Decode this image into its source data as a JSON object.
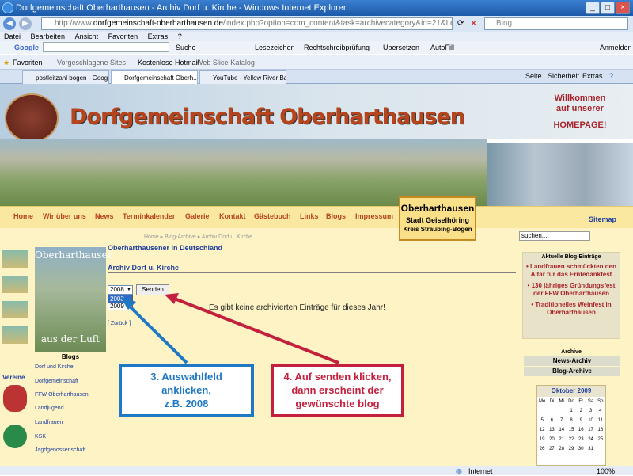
{
  "window": {
    "title": "Dorfgemeinschaft Oberharthausen - Archiv Dorf u. Kirche - Windows Internet Explorer"
  },
  "address": {
    "url_prefix": "http://www.",
    "url_domain": "dorfgemeinschaft-oberharthausen.de",
    "url_rest": "/index.php?option=com_content&task=archivecategory&id=21&Itemid=102",
    "search_placeholder": "Bing"
  },
  "menu": [
    "Datei",
    "Bearbeiten",
    "Ansicht",
    "Favoriten",
    "Extras",
    "?"
  ],
  "google_toolbar": {
    "logo": "Google",
    "suche": "Suche",
    "lesezeichen": "Lesezeichen",
    "rechtschreib": "Rechtschreibprüfung",
    "uebersetzen": "Übersetzen",
    "autofill": "AutoFill",
    "anmelden": "Anmelden"
  },
  "favorites_bar": {
    "favoriten": "Favoriten",
    "vorgeschlagen": "Vorgeschlagene Sites",
    "hotmail": "Kostenlose Hotmail",
    "webslice": "Web Slice-Katalog"
  },
  "tabs": [
    "postleitzahl bogen - Google-S...",
    "Dorfgemeinschaft Oberh...",
    "YouTube - Yellow River Band ..."
  ],
  "cmdbar": {
    "seite": "Seite",
    "sicherheit": "Sicherheit",
    "extras": "Extras"
  },
  "site": {
    "title": "Dorfgemeinschaft Oberharthausen",
    "welcome1": "Willkommen",
    "welcome2": "auf unserer",
    "homepage": "HOMEPAGE!",
    "nav": [
      "Home",
      "Wir über uns",
      "News",
      "Terminkalender",
      "Galerie",
      "Kontakt",
      "Gästebuch",
      "Links",
      "Blogs",
      "Impressum"
    ],
    "location": {
      "name": "Oberharthausen",
      "city": "Stadt Geiselhöring",
      "district": "Kreis Straubing-Bogen"
    },
    "sitemap": "Sitemap",
    "search_placeholder": "suchen...",
    "breadcrumb": "Home ▸ Blog-Archive ▸ Archiv Dorf u. Kirche",
    "section_title": "Oberharthausener in Deutschland",
    "archive_title": "Archiv Dorf u. Kirche",
    "select_value": "2008",
    "select_options": [
      "2008",
      "2009"
    ],
    "send_label": "Senden",
    "no_entries": "Es gibt keine archivierten Einträge für dieses Jahr!",
    "back_link": "[ Zurück ]",
    "left_image_top": "Oberharthausen",
    "left_image_bottom": "aus der Luft",
    "blogs_head": "Blogs",
    "blog_links": [
      "Dorf und Kirche",
      "Dorfgemeinschaft",
      "FFW Oberharthausen",
      "Landjugend",
      "Landfrauen",
      "KSK",
      "Jagdgenossenschaft"
    ],
    "vereine": "Vereine",
    "recent_head": "Aktuelle Blog-Einträge",
    "recent_items": [
      "Landfrauen schmückten den Altar für das Erntedankfest",
      "130 jähriges Gründungsfest der FFW Oberharthausen",
      "Traditionelles Weinfest in Oberharthausen"
    ],
    "archive_head": "Archive",
    "archive_links": [
      "News-Archiv",
      "Blog-Archive"
    ],
    "calendar": {
      "month": "Oktober 2009",
      "weekdays": [
        "Mo",
        "Di",
        "Mi",
        "Do",
        "Fr",
        "Sa",
        "So"
      ],
      "weeks": [
        [
          "",
          "",
          "",
          "1",
          "2",
          "3",
          "4"
        ],
        [
          "5",
          "6",
          "7",
          "8",
          "9",
          "10",
          "11"
        ],
        [
          "12",
          "13",
          "14",
          "15",
          "16",
          "17",
          "18"
        ],
        [
          "19",
          "20",
          "21",
          "22",
          "23",
          "24",
          "25"
        ],
        [
          "26",
          "27",
          "28",
          "29",
          "30",
          "31",
          ""
        ]
      ]
    }
  },
  "callouts": {
    "step3": [
      "3. Auswahlfeld",
      "anklicken,",
      "z.B. 2008"
    ],
    "step4": [
      "4. Auf senden klicken,",
      "dann erscheint der",
      "gewünschte blog"
    ]
  },
  "status": {
    "zone": "Internet",
    "zoom": "100%"
  },
  "colors": {
    "title_brown": "#b6441c",
    "link_blue": "#1f3fa0",
    "callout_blue": "#1e78c3",
    "callout_red": "#c3203d",
    "content_bg": "#fdf3c4"
  }
}
